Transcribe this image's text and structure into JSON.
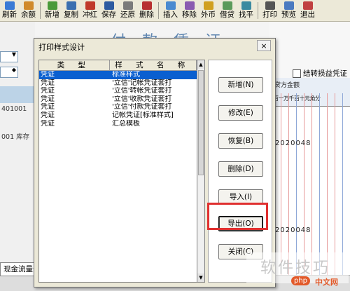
{
  "toolbar": {
    "items": [
      {
        "label": "刷新",
        "icon": "refresh-icon",
        "color": "#3a7bd5"
      },
      {
        "label": "余额",
        "icon": "balance-icon",
        "color": "#d08a2a"
      },
      {
        "label": "新增",
        "icon": "new-icon",
        "color": "#4a9a3a"
      },
      {
        "label": "复制",
        "icon": "copy-icon",
        "color": "#3a6fb0"
      },
      {
        "label": "冲红",
        "icon": "reverse-icon",
        "color": "#c0392b"
      },
      {
        "label": "保存",
        "icon": "save-icon",
        "color": "#2c5aa0"
      },
      {
        "label": "还原",
        "icon": "restore-icon",
        "color": "#7a7a7a"
      },
      {
        "label": "删除",
        "icon": "delete-icon",
        "color": "#b83030"
      },
      {
        "label": "插入",
        "icon": "insert-icon",
        "color": "#4a8ad0"
      },
      {
        "label": "移除",
        "icon": "remove-icon",
        "color": "#8a5ab0"
      },
      {
        "label": "外币",
        "icon": "currency-icon",
        "color": "#d0a020"
      },
      {
        "label": "借贷",
        "icon": "debit-credit-icon",
        "color": "#5a9a5a"
      },
      {
        "label": "找平",
        "icon": "balance-level-icon",
        "color": "#3a8aa0"
      },
      {
        "label": "打印",
        "icon": "print-icon",
        "color": "#555555"
      },
      {
        "label": "预览",
        "icon": "preview-icon",
        "color": "#4a7ac0"
      },
      {
        "label": "退出",
        "icon": "exit-icon",
        "color": "#c04040"
      }
    ]
  },
  "background": {
    "voucher_title": "付 款 凭 证",
    "left_code": "401001",
    "left_text": "001  库存",
    "checkbox_label": "结转损益凭证",
    "grid_header_top": "贷方金额",
    "grid_header_digits": "百十万千百十元角分",
    "amount_1": "2020048",
    "amount_2": "2020048",
    "bottom_tab": "现金流量分配"
  },
  "dialog": {
    "title": "打印样式设计",
    "close_label": "×",
    "columns": [
      "类 型",
      "样 式 名 称"
    ],
    "rows": [
      {
        "type": "凭证",
        "name": "标准样式",
        "selected": true
      },
      {
        "type": "凭证",
        "name": "'立信'记帐凭证套打"
      },
      {
        "type": "凭证",
        "name": "'立信'转帐凭证套打"
      },
      {
        "type": "凭证",
        "name": "'立信'收款凭证套打"
      },
      {
        "type": "凭证",
        "name": "'立信'付款凭证套打"
      },
      {
        "type": "凭证",
        "name": "记帐凭证[标准样式]"
      },
      {
        "type": "凭证",
        "name": "汇总模板"
      }
    ],
    "buttons": {
      "new": "新增(N)",
      "edit": "修改(E)",
      "restore": "恢复(B)",
      "delete": "删除(D)",
      "import": "导入(I)",
      "export": "导出(O)",
      "close": "关闭(C)"
    },
    "highlight_color": "#e03030"
  },
  "watermark": {
    "text": "软件技巧",
    "badge": "php",
    "site": "中文网"
  }
}
